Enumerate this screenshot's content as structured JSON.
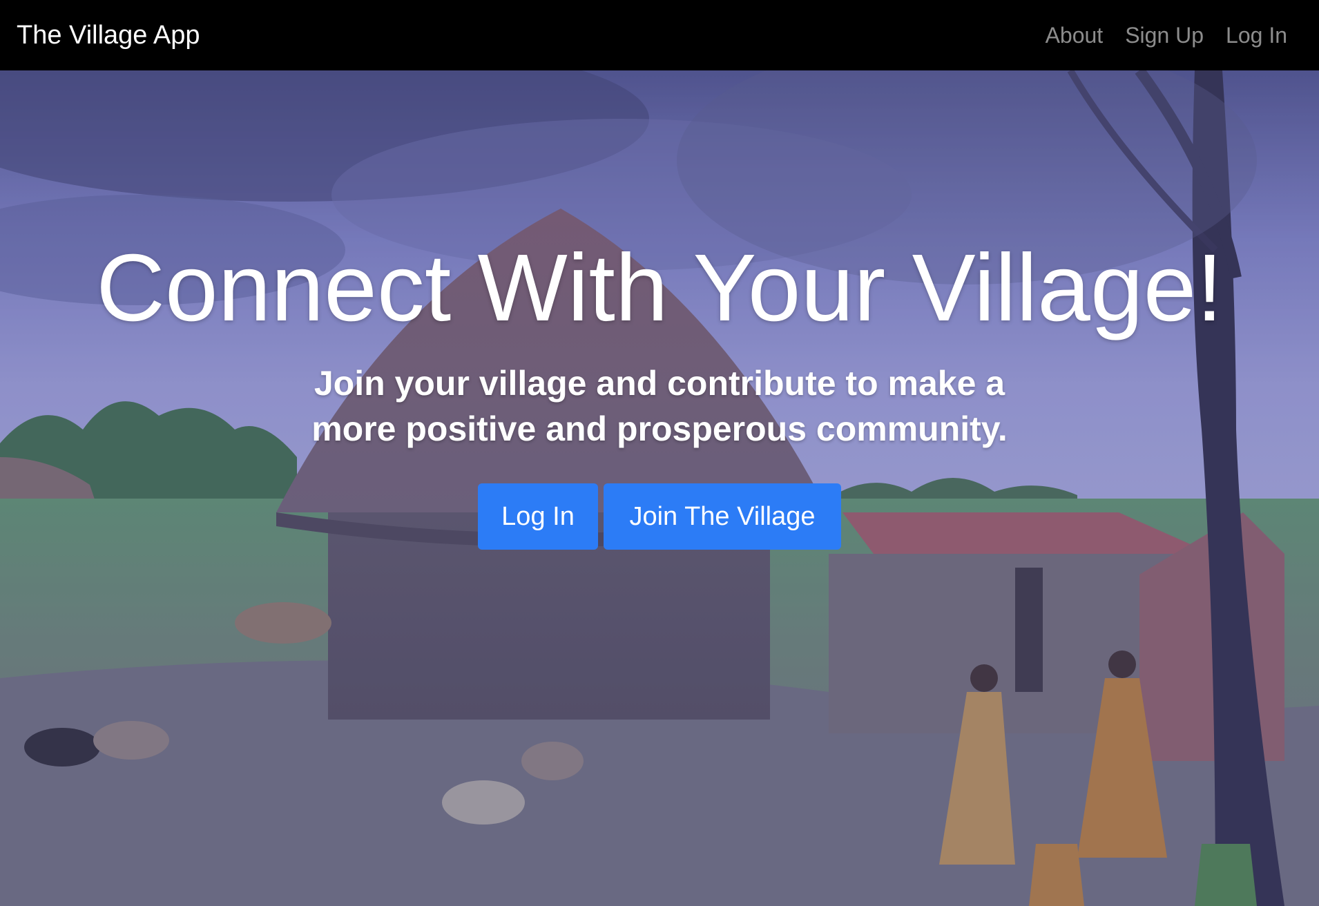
{
  "navbar": {
    "brand": "The Village App",
    "links": [
      {
        "label": "About"
      },
      {
        "label": "Sign Up"
      },
      {
        "label": "Log In"
      }
    ]
  },
  "hero": {
    "title": "Connect With Your Village!",
    "lead": "Join your village and contribute to make a more positive and prosperous community.",
    "buttons": {
      "login_label": "Log In",
      "join_label": "Join The Village"
    }
  },
  "colors": {
    "navbar_bg": "#000000",
    "nav_link": "#8c8c8c",
    "button_primary": "#2c7cf6",
    "text": "#ffffff"
  }
}
